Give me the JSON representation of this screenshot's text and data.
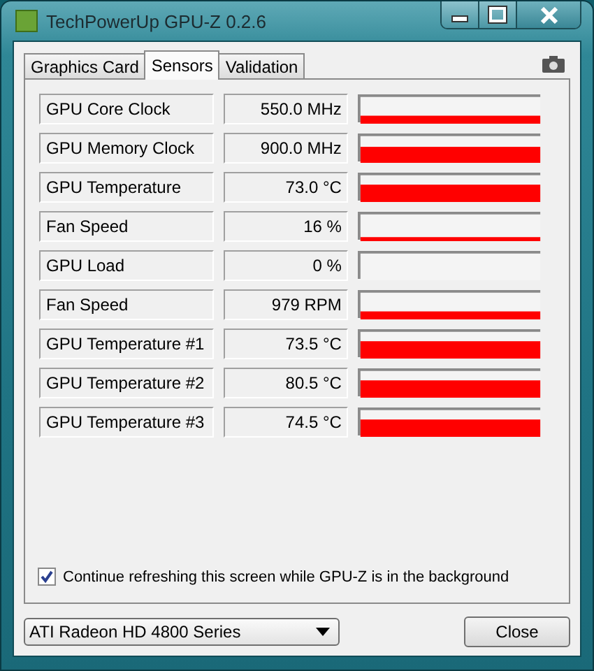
{
  "window": {
    "title": "TechPowerUp GPU-Z 0.2.6"
  },
  "tabs": [
    {
      "label": "Graphics Card",
      "selected": false
    },
    {
      "label": "Sensors",
      "selected": true
    },
    {
      "label": "Validation",
      "selected": false
    }
  ],
  "sensors": [
    {
      "name": "GPU Core Clock",
      "value": "550.0 MHz"
    },
    {
      "name": "GPU Memory Clock",
      "value": "900.0 MHz"
    },
    {
      "name": "GPU Temperature",
      "value": "73.0 °C"
    },
    {
      "name": "Fan Speed",
      "value": "16 %"
    },
    {
      "name": "GPU Load",
      "value": "0 %"
    },
    {
      "name": "Fan Speed",
      "value": "979 RPM"
    },
    {
      "name": "GPU Temperature #1",
      "value": "73.5 °C"
    },
    {
      "name": "GPU Temperature #2",
      "value": "80.5 °C"
    },
    {
      "name": "GPU Temperature #3",
      "value": "74.5 °C"
    }
  ],
  "refresh": {
    "label": "Continue refreshing this screen while GPU-Z is in the background",
    "checked": true
  },
  "gpu_select": {
    "value": "ATI Radeon HD 4800 Series"
  },
  "buttons": [
    "Close"
  ]
}
